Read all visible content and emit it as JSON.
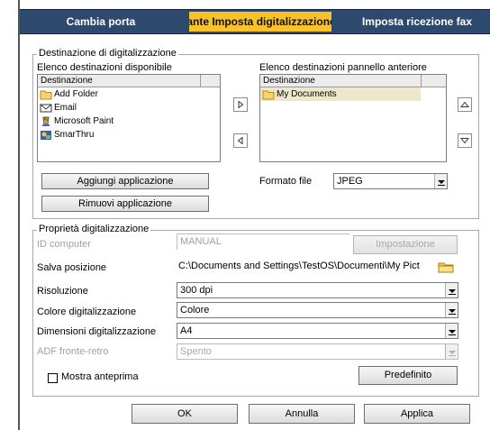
{
  "tabs": [
    {
      "label": "Cambia porta"
    },
    {
      "label": "Pulsante Imposta digitalizzazione"
    },
    {
      "label": "Imposta ricezione fax"
    }
  ],
  "destination_group": {
    "title": "Destinazione di digitalizzazione",
    "available_label": "Elenco destinazioni disponibile",
    "available_header": "Destinazione",
    "available_items": [
      {
        "label": "Add Folder",
        "icon": "folder-icon"
      },
      {
        "label": "Email",
        "icon": "email-icon"
      },
      {
        "label": "Microsoft Paint",
        "icon": "paint-icon"
      },
      {
        "label": "SmarThru",
        "icon": "smarthru-icon"
      }
    ],
    "front_panel_label": "Elenco destinazioni pannello anteriore",
    "front_panel_header": "Destinazione",
    "front_panel_items": [
      {
        "label": "My Documents",
        "icon": "folder-icon"
      }
    ],
    "add_app_button": "Aggiungi applicazione",
    "remove_app_button": "Rimuovi applicazione",
    "file_format_label": "Formato file",
    "file_format_value": "JPEG"
  },
  "properties_group": {
    "title": "Proprietà digitalizzazione",
    "computer_id_label": "ID computer",
    "computer_id_value": "MANUAL",
    "settings_button": "Impostazione",
    "save_location_label": "Salva posizione",
    "save_location_value": "C:\\Documents and Settings\\TestOS\\Documenti\\My Pict",
    "resolution_label": "Risoluzione",
    "resolution_value": "300 dpi",
    "color_label": "Colore digitalizzazione",
    "color_value": "Colore",
    "size_label": "Dimensioni digitalizzazione",
    "size_value": "A4",
    "adf_label": "ADF fronte-retro",
    "adf_value": "Spento",
    "preview_label": "Mostra anteprima",
    "default_button": "Predefinito"
  },
  "footer": {
    "ok_button": "OK",
    "cancel_button": "Annulla",
    "apply_button": "Applica"
  }
}
